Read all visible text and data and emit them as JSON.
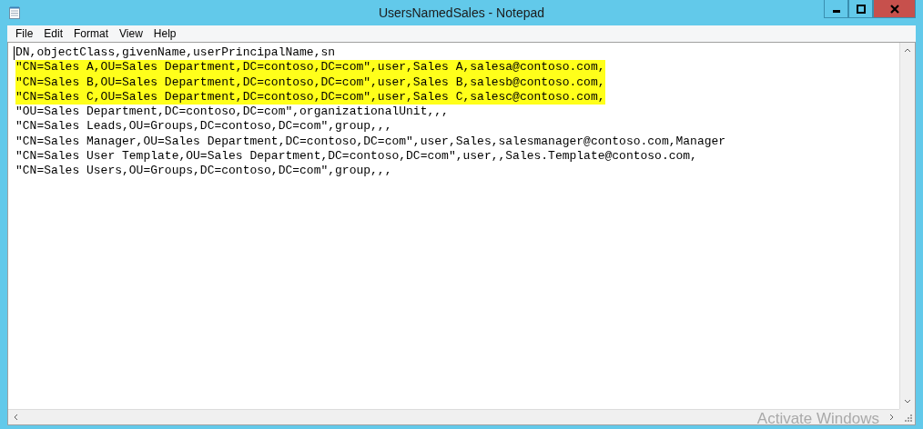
{
  "window": {
    "title": "UsersNamedSales - Notepad"
  },
  "menu": [
    "File",
    "Edit",
    "Format",
    "View",
    "Help"
  ],
  "lines": [
    {
      "text": "DN,objectClass,givenName,userPrincipalName,sn",
      "highlighted": false
    },
    {
      "text": "\"CN=Sales A,OU=Sales Department,DC=contoso,DC=com\",user,Sales A,salesa@contoso.com,",
      "highlighted": true
    },
    {
      "text": "\"CN=Sales B,OU=Sales Department,DC=contoso,DC=com\",user,Sales B,salesb@contoso.com,",
      "highlighted": true
    },
    {
      "text": "\"CN=Sales C,OU=Sales Department,DC=contoso,DC=com\",user,Sales C,salesc@contoso.com,",
      "highlighted": true
    },
    {
      "text": "\"OU=Sales Department,DC=contoso,DC=com\",organizationalUnit,,,",
      "highlighted": false
    },
    {
      "text": "\"CN=Sales Leads,OU=Groups,DC=contoso,DC=com\",group,,,",
      "highlighted": false
    },
    {
      "text": "\"CN=Sales Manager,OU=Sales Department,DC=contoso,DC=com\",user,Sales,salesmanager@contoso.com,Manager",
      "highlighted": false
    },
    {
      "text": "\"CN=Sales User Template,OU=Sales Department,DC=contoso,DC=com\",user,,Sales.Template@contoso.com,",
      "highlighted": false
    },
    {
      "text": "\"CN=Sales Users,OU=Groups,DC=contoso,DC=com\",group,,,",
      "highlighted": false
    }
  ],
  "overlay": {
    "text": "Activate Windows"
  }
}
